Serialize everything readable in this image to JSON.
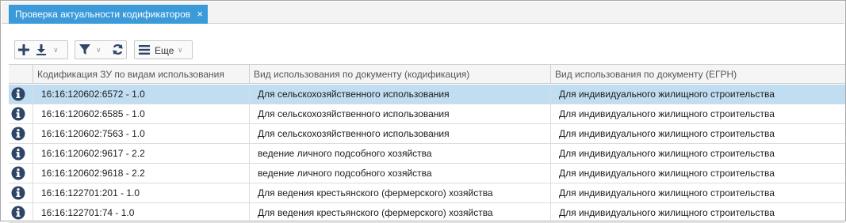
{
  "tab": {
    "title": "Проверка актуальности кодификаторов",
    "close_glyph": "×"
  },
  "toolbar": {
    "more_label": "Еще"
  },
  "colors": {
    "tab_bg": "#3b9ad9",
    "selected_row": "#c1ddf1",
    "icon": "#2e4566"
  },
  "table": {
    "columns": [
      "Кодификация ЗУ по видам использования",
      "Вид использования по документу (кодификация)",
      "Вид использования по документу (ЕГРН)"
    ],
    "rows": [
      {
        "code": "16:16:120602:6572 - 1.0",
        "codif": "Для сельскохозяйственного использования",
        "egrn": "Для индивидуального жилищного строительства"
      },
      {
        "code": "16:16:120602:6585 - 1.0",
        "codif": "Для сельскохозяйственного использования",
        "egrn": "Для индивидуального жилищного строительства"
      },
      {
        "code": "16:16:120602:7563 - 1.0",
        "codif": "Для сельскохозяйственного использования",
        "egrn": "Для индивидуального жилищного строительства"
      },
      {
        "code": "16:16:120602:9617 - 2.2",
        "codif": "ведение личного подсобного хозяйства",
        "egrn": "Для индивидуального жилищного строительства"
      },
      {
        "code": "16:16:120602:9618 - 2.2",
        "codif": "ведение личного подсобного хозяйства",
        "egrn": "Для индивидуального жилищного строительства"
      },
      {
        "code": "16:16:122701:201 - 1.0",
        "codif": "Для ведения крестьянского (фермерского) хозяйства",
        "egrn": "Для индивидуального жилищного строительства"
      },
      {
        "code": "16:16:122701:74 - 1.0",
        "codif": "Для ведения крестьянского (фермерского) хозяйства",
        "egrn": "Для индивидуального жилищного строительства"
      }
    ]
  }
}
